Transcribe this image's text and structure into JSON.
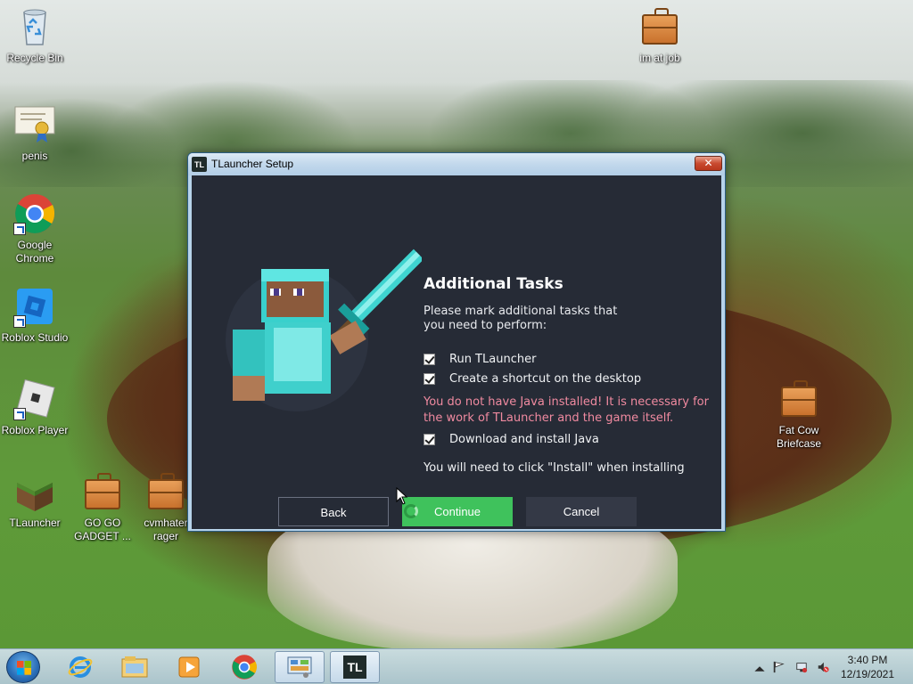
{
  "desktop": {
    "icons": [
      {
        "label": "Recycle Bin",
        "icon": "recycle-bin-icon"
      },
      {
        "label": "penis",
        "icon": "certificate-icon"
      },
      {
        "label": "Google Chrome",
        "icon": "chrome-icon"
      },
      {
        "label": "Roblox Studio",
        "icon": "roblox-studio-icon"
      },
      {
        "label": "Roblox Player",
        "icon": "roblox-player-icon"
      },
      {
        "label": "TLauncher",
        "icon": "tlauncher-grass-block-icon"
      },
      {
        "label": "GO GO GADGET ...",
        "icon": "briefcase-icon"
      },
      {
        "label": "cvmhater rager",
        "icon": "briefcase-icon"
      },
      {
        "label": "im at job",
        "icon": "briefcase-icon"
      },
      {
        "label": "Fat Cow Briefcase",
        "icon": "briefcase-icon"
      }
    ]
  },
  "window": {
    "app_icon_text": "TL",
    "title": "TLauncher Setup",
    "close_glyph": "✕",
    "heading": "Additional Tasks",
    "description": "Please mark additional tasks that you need to perform:",
    "tasks": [
      {
        "label": "Run TLauncher",
        "checked": true
      },
      {
        "label": "Create a shortcut on the desktop",
        "checked": true
      }
    ],
    "warning": "You do not have Java installed! It is necessary for the work of TLauncher and the game itself.",
    "java_task": {
      "label": "Download and install Java",
      "checked": true
    },
    "note": "You will need to click \"Install\" when installing",
    "buttons": {
      "back": "Back",
      "continue": "Continue",
      "cancel": "Cancel"
    }
  },
  "taskbar": {
    "pinned": [
      "start-orb",
      "internet-explorer-icon",
      "windows-explorer-icon",
      "media-player-icon",
      "chrome-icon",
      "control-panel-icon",
      "tlauncher-icon"
    ],
    "tlauncher_text": "TL",
    "clock": {
      "time": "3:40 PM",
      "date": "12/19/2021"
    },
    "tray": [
      "show-hidden-icons-icon",
      "action-center-flag-icon",
      "network-icon",
      "volume-muted-icon"
    ]
  },
  "colors": {
    "dialog_bg": "#262b36",
    "continue_green": "#3fc25c",
    "warning_pink": "#f08aa0",
    "cancel_bg": "#343946"
  }
}
